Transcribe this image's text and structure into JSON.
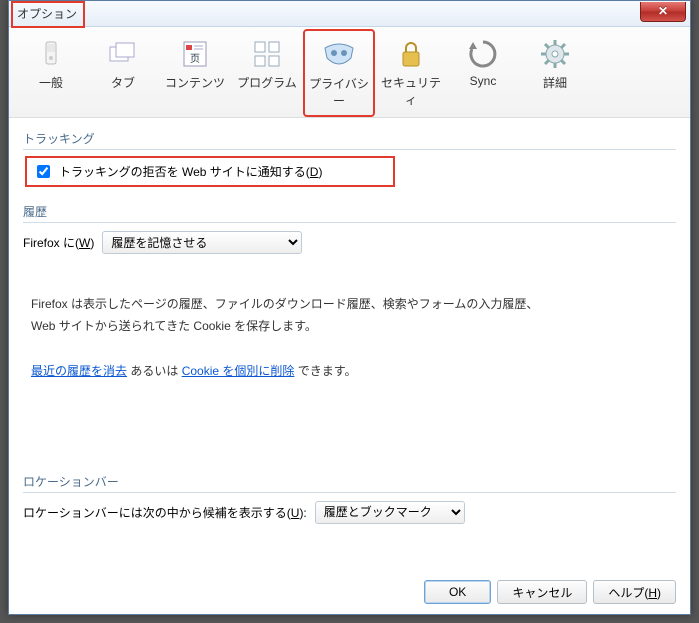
{
  "window": {
    "title": "オプション",
    "close_glyph": "✕"
  },
  "toolbar": {
    "items": [
      {
        "label": "一般"
      },
      {
        "label": "タブ"
      },
      {
        "label": "コンテンツ"
      },
      {
        "label": "プログラム"
      },
      {
        "label": "プライバシー"
      },
      {
        "label": "セキュリティ"
      },
      {
        "label": "Sync"
      },
      {
        "label": "詳細"
      }
    ]
  },
  "tracking": {
    "section": "トラッキング",
    "checkbox_label_pre": "トラッキングの拒否を Web サイトに通知する(",
    "accel": "D",
    "checkbox_label_post": ")"
  },
  "history": {
    "section": "履歴",
    "label_pre": "Firefox に(",
    "label_accel": "W",
    "label_post": ")",
    "combo_value": "履歴を記憶させる",
    "desc1": "Firefox は表示したページの履歴、ファイルのダウンロード履歴、検索やフォームの入力履歴、",
    "desc2": "Web サイトから送られてきた Cookie を保存します。",
    "link1": "最近の履歴を消去",
    "mid": " あるいは ",
    "link2": "Cookie を個別に削除",
    "tail": " できます。"
  },
  "location": {
    "section": "ロケーションバー",
    "label_pre": "ロケーションバーには次の中から候補を表示する(",
    "label_accel": "U",
    "label_post": "):",
    "combo_value": "履歴とブックマーク"
  },
  "footer": {
    "ok": "OK",
    "cancel": "キャンセル",
    "help_pre": "ヘルプ(",
    "help_accel": "H",
    "help_post": ")"
  }
}
